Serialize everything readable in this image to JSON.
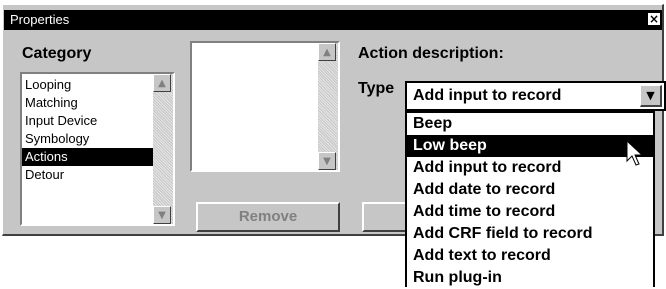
{
  "window": {
    "title": "Properties",
    "close_label": "×"
  },
  "category": {
    "label": "Category",
    "items": [
      "Looping",
      "Matching",
      "Input Device",
      "Symbology",
      "Actions",
      "Detour"
    ],
    "selected_index": 4
  },
  "middle_list": {
    "items": []
  },
  "remove_button": {
    "label": "Remove"
  },
  "action_description": {
    "label": "Action description:"
  },
  "type_field": {
    "label": "Type",
    "value": "Add input to record",
    "options": [
      "Beep",
      "Low beep",
      "Add input to record",
      "Add date to record",
      "Add time to record",
      "Add CRF field to record",
      "Add text to record",
      "Run plug-in"
    ],
    "highlighted_index": 1
  },
  "scroll_icons": {
    "up": "▲",
    "down": "▼"
  },
  "colors": {
    "selection_bg": "#000000",
    "selection_fg": "#ffffff",
    "window_bg": "#c6c6c6"
  }
}
